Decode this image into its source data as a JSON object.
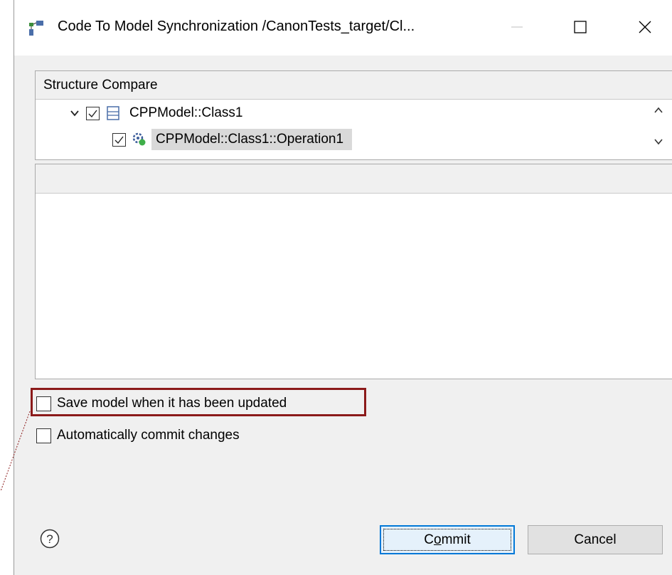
{
  "window": {
    "title": "Code To Model Synchronization /CanonTests_target/Cl...",
    "controls": [
      "minimize",
      "maximize",
      "close"
    ]
  },
  "structure_compare": {
    "header": "Structure Compare",
    "tree": [
      {
        "label": "CPPModel::Class1",
        "checked": true,
        "expanded": true,
        "icon": "class-icon"
      },
      {
        "label": "CPPModel::Class1::Operation1",
        "checked": true,
        "selected": true,
        "icon": "operation-icon"
      }
    ]
  },
  "options": {
    "save_model": {
      "label": "Save model when it has been updated",
      "checked": false
    },
    "auto_commit": {
      "label": "Automatically commit changes",
      "checked": false
    }
  },
  "buttons": {
    "commit_mnemonic_pre": "C",
    "commit_mnemonic": "o",
    "commit_mnemonic_post": "mmit",
    "cancel": "Cancel"
  },
  "colors": {
    "accent": "#0078d7",
    "highlight_border": "#8b1a1a",
    "selection": "#d9d9d9"
  }
}
